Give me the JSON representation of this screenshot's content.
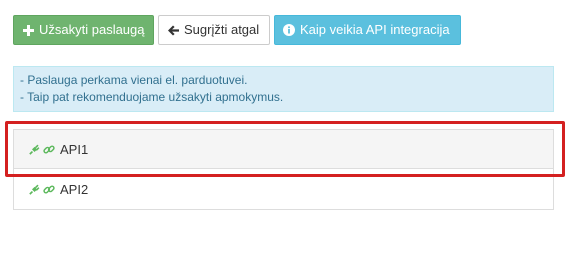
{
  "toolbar": {
    "order_label": "Užsakyti paslaugą",
    "back_label": "Sugrįžti atgal",
    "info_label": "Kaip veikia API integracija"
  },
  "alert": {
    "lines": [
      "- Paslauga perkama vienai el. parduotuvei.",
      "- Taip pat rekomenduojame užsakyti apmokymus."
    ]
  },
  "integrations": [
    {
      "label": "API1",
      "icons": [
        "plug-icon",
        "link-icon"
      ]
    },
    {
      "label": "API2",
      "icons": [
        "plug-icon",
        "link-icon"
      ]
    }
  ],
  "colors": {
    "success": "#6fb46f",
    "info": "#5bc0de",
    "icon_green": "#5cb85c",
    "highlight": "#d42020"
  }
}
